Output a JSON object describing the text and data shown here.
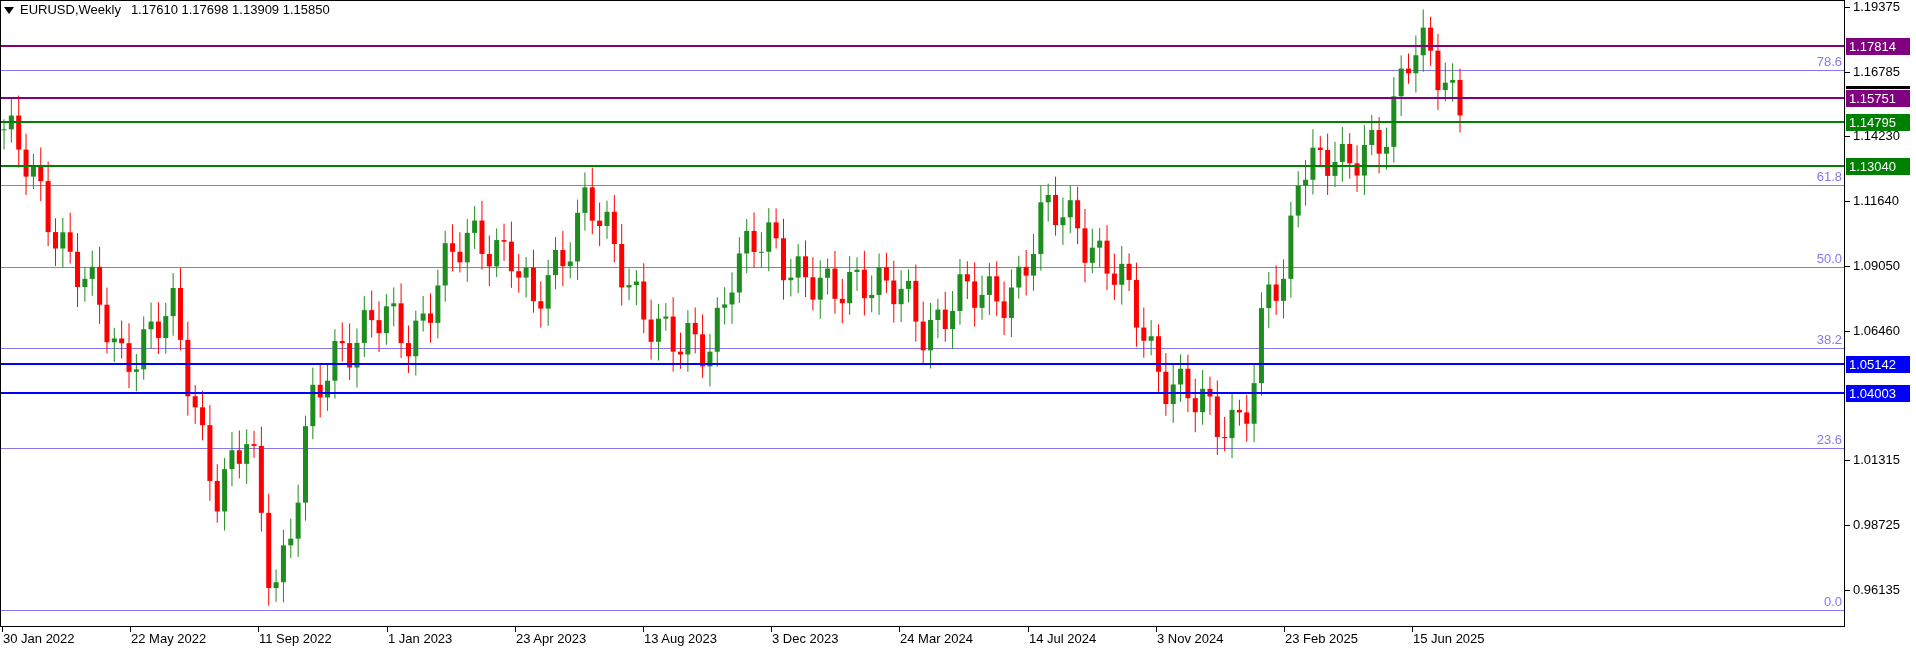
{
  "header": {
    "symbol": "EURUSD,Weekly",
    "ohlc": "1.17610 1.17698 1.13909 1.15850"
  },
  "price_ticks": [
    "1.19375",
    "1.16785",
    "1.14230",
    "1.11640",
    "1.09050",
    "1.06460",
    "1.01315",
    "0.98725",
    "0.96135"
  ],
  "level_lines": [
    {
      "price": "1.17814",
      "color": "#800080"
    },
    {
      "price": "1.15751",
      "color": "#800080"
    },
    {
      "price": "1.14795",
      "color": "#008000"
    },
    {
      "price": "1.13040",
      "color": "#008000"
    },
    {
      "price": "1.05142",
      "color": "#0000ff"
    },
    {
      "price": "1.04003",
      "color": "#0000ff"
    }
  ],
  "fibonacci_levels": [
    "78.6",
    "61.8",
    "50.0",
    "38.2",
    "23.6",
    "0.0"
  ],
  "date_ticks": [
    "30 Jan 2022",
    "22 May 2022",
    "11 Sep 2022",
    "1 Jan 2023",
    "23 Apr 2023",
    "13 Aug 2023",
    "3 Dec 2023",
    "24 Mar 2024",
    "14 Jul 2024",
    "3 Nov 2024",
    "23 Feb 2025",
    "15 Jun 2025"
  ]
}
